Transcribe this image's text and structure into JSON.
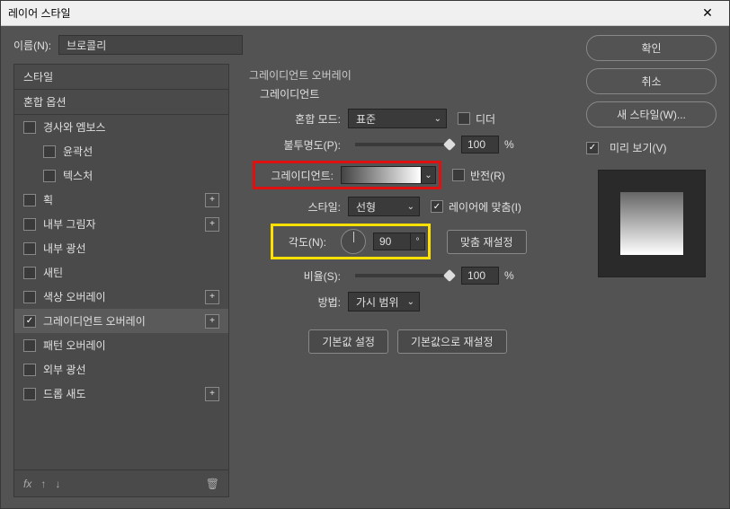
{
  "window": {
    "title": "레이어 스타일"
  },
  "name": {
    "label": "이름(N):",
    "value": "브로콜리"
  },
  "sidebar": {
    "header": "스타일",
    "blend": "혼합 옵션",
    "items": [
      {
        "label": "경사와 엠보스",
        "checked": false,
        "plus": false,
        "sub": false
      },
      {
        "label": "윤곽선",
        "checked": false,
        "plus": false,
        "sub": true
      },
      {
        "label": "텍스처",
        "checked": false,
        "plus": false,
        "sub": true
      },
      {
        "label": "획",
        "checked": false,
        "plus": true,
        "sub": false
      },
      {
        "label": "내부 그림자",
        "checked": false,
        "plus": true,
        "sub": false
      },
      {
        "label": "내부 광선",
        "checked": false,
        "plus": false,
        "sub": false
      },
      {
        "label": "새틴",
        "checked": false,
        "plus": false,
        "sub": false
      },
      {
        "label": "색상 오버레이",
        "checked": false,
        "plus": true,
        "sub": false
      },
      {
        "label": "그레이디언트 오버레이",
        "checked": true,
        "plus": true,
        "sub": false,
        "selected": true
      },
      {
        "label": "패턴 오버레이",
        "checked": false,
        "plus": false,
        "sub": false
      },
      {
        "label": "외부 광선",
        "checked": false,
        "plus": false,
        "sub": false
      },
      {
        "label": "드롭 새도",
        "checked": false,
        "plus": true,
        "sub": false
      }
    ],
    "footer": {
      "fx": "fx"
    }
  },
  "center": {
    "title": "그레이디언트 오버레이",
    "subtitle": "그레이디언트",
    "blend_mode_label": "혼합 모드:",
    "blend_mode_value": "표준",
    "dither_label": "디더",
    "opacity_label": "불투명도(P):",
    "opacity_value": "100",
    "percent": "%",
    "gradient_label": "그레이디언트:",
    "reverse_label": "반전(R)",
    "style_label": "스타일:",
    "style_value": "선형",
    "align_label": "레이어에 맞춤(I)",
    "angle_label": "각도(N):",
    "angle_value": "90",
    "angle_unit": "°",
    "reset_align_btn": "맞춤 재설정",
    "scale_label": "비율(S):",
    "scale_value": "100",
    "method_label": "방법:",
    "method_value": "가시 범위",
    "default_set": "기본값 설정",
    "default_reset": "기본값으로 재설정"
  },
  "right": {
    "ok": "확인",
    "cancel": "취소",
    "new_style": "새 스타일(W)...",
    "preview_label": "미리 보기(V)"
  }
}
